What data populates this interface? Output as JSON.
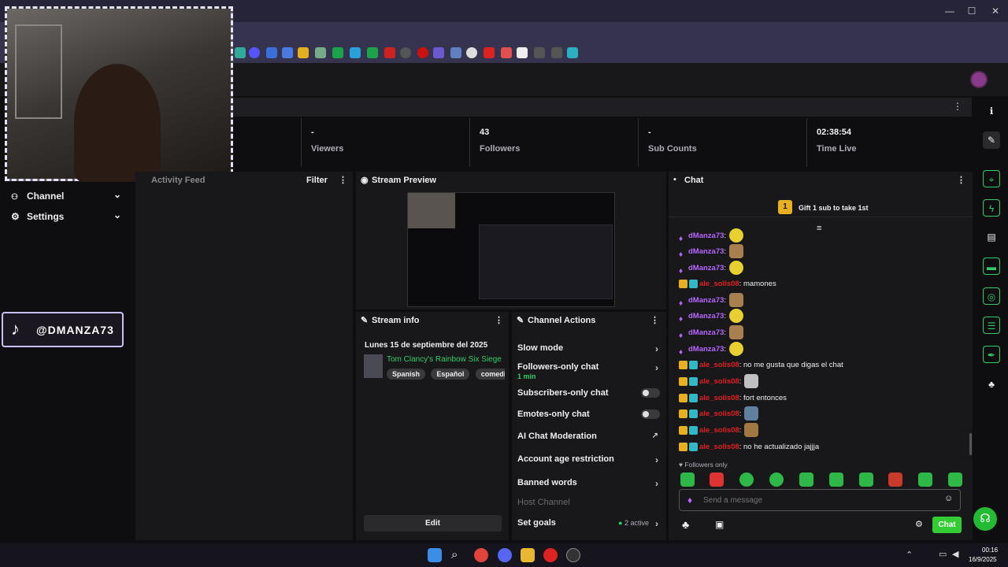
{
  "browser": {
    "minimize": "—",
    "maximize": "☐",
    "close": "✕"
  },
  "stats": [
    {
      "value": "-",
      "label": "Viewers"
    },
    {
      "value": "43",
      "label": "Followers"
    },
    {
      "value": "-",
      "label": "Sub Counts"
    },
    {
      "value": "02:38:54",
      "label": "Time Live"
    }
  ],
  "leftnav": {
    "channel": "Channel",
    "settings": "Settings"
  },
  "overlay": {
    "tiktok_handle": "@DMANZA73"
  },
  "activity": {
    "title": "Activity Feed",
    "filter": "Filter"
  },
  "preview": {
    "title": "Stream Preview"
  },
  "streaminfo": {
    "title": "Stream info",
    "stream_title": "Lunes 15 de septiembre del 2025",
    "game": "Tom Clancy's Rainbow Six Siege",
    "tags": [
      "Spanish",
      "Español",
      "comedia"
    ],
    "edit": "Edit"
  },
  "actions": {
    "title": "Channel Actions",
    "slow_mode": "Slow mode",
    "followers_only": "Followers-only chat",
    "followers_only_sub": "1 min",
    "subscribers_only": "Subscribers-only chat",
    "emotes_only": "Emotes-only chat",
    "ai_moderation": "AI Chat Moderation",
    "account_age": "Account age restriction",
    "banned_words": "Banned words",
    "host_channel": "Host Channel",
    "set_goals": "Set goals",
    "set_goals_status": "2 active"
  },
  "chat": {
    "title": "Chat",
    "gift_count": "1",
    "gift_text": "Gift 1 sub to take 1st",
    "messages": [
      {
        "user": "dManza73",
        "text": ":",
        "kind": "emote"
      },
      {
        "user": "dManza73",
        "text": ":",
        "kind": "emote"
      },
      {
        "user": "dManza73",
        "text": ":",
        "kind": "emote"
      },
      {
        "user": "ale_solis08",
        "text": ": mamones",
        "kind": "text"
      },
      {
        "user": "dManza73",
        "text": ":",
        "kind": "emote"
      },
      {
        "user": "dManza73",
        "text": ":",
        "kind": "emote"
      },
      {
        "user": "dManza73",
        "text": ":",
        "kind": "emote"
      },
      {
        "user": "dManza73",
        "text": ":",
        "kind": "emote"
      },
      {
        "user": "ale_solis08",
        "text": ": no me gusta que digas el chat",
        "kind": "text"
      },
      {
        "user": "ale_solis08",
        "text": ":",
        "kind": "emote"
      },
      {
        "user": "ale_solis08",
        "text": ": fort entonces",
        "kind": "text"
      },
      {
        "user": "ale_solis08",
        "text": ":",
        "kind": "emote"
      },
      {
        "user": "ale_solis08",
        "text": ":",
        "kind": "emote"
      },
      {
        "user": "ale_solis08",
        "text": ": no he actualizado jajjja",
        "kind": "text"
      }
    ],
    "followers_only": "Followers only",
    "placeholder": "Send a message",
    "send": "Chat"
  },
  "taskbar": {
    "time": "00:16",
    "date": "16/9/2025"
  },
  "colors": {
    "twitch_purple": "#9147ff",
    "accent_green": "#33cc66",
    "user_red": "#e02020",
    "user_purple": "#b866ff"
  }
}
